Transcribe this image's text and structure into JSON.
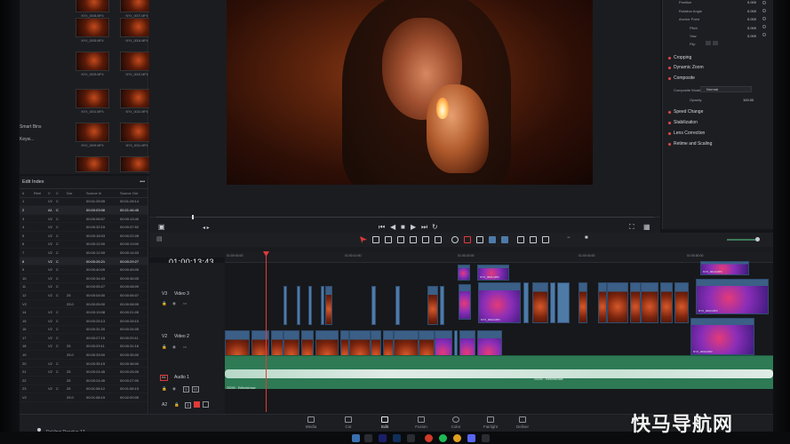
{
  "media_pool": {
    "clip_labels": [
      "NYX_0008.MP4",
      "NYX_0007.MP4",
      "NYX_0005.MP4",
      "NYX_0004.MP4",
      "NYX_0003.MP4",
      "NYX_0002.MP4",
      "NYX_0001.MP4",
      "NYX_0010.MP4",
      "NYX_0009.MP4",
      "NYX_0011.MP4"
    ],
    "smart_bins_label": "Smart Bins",
    "keywords_label": "Keyw..."
  },
  "edit_index": {
    "title": "Edit Index",
    "more": "•••",
    "columns": [
      "#",
      "Reel",
      "V",
      "C",
      "Dur",
      "Source In",
      "Source Out"
    ],
    "rows": [
      [
        "1",
        "",
        "V2",
        "C",
        "",
        "00:01:25:05",
        "00:01:28:14"
      ],
      [
        "2",
        "",
        "A1",
        "C",
        "",
        "00:00:03:06",
        "00:21:46:45"
      ],
      [
        "3",
        "",
        "V2",
        "C",
        "",
        "00:00:08:07",
        "00:00:13:40"
      ],
      [
        "4",
        "",
        "V2",
        "C",
        "",
        "00:00:32:15",
        "00:00:37:52"
      ],
      [
        "5",
        "",
        "V2",
        "C",
        "",
        "00:00:18:03",
        "00:00:22:28"
      ],
      [
        "6",
        "",
        "V2",
        "C",
        "",
        "00:00:12:00",
        "00:00:13:00"
      ],
      [
        "7",
        "",
        "V2",
        "C",
        "",
        "00:00:12:09",
        "00:00:14:03"
      ],
      [
        "8",
        "",
        "V2",
        "C",
        "",
        "00:00:26:21",
        "00:00:29:27"
      ],
      [
        "9",
        "",
        "V2",
        "C",
        "",
        "00:00:40:09",
        "00:00:45:05"
      ],
      [
        "10",
        "",
        "V2",
        "C",
        "",
        "00:00:34:43",
        "00:00:36:05"
      ],
      [
        "11",
        "",
        "V2",
        "C",
        "",
        "00:00:05:27",
        "00:00:08:09"
      ],
      [
        "12",
        "",
        "V2",
        "C",
        "25",
        "00:00:04:00",
        "00:00:06:07"
      ],
      [
        "V2",
        "",
        "",
        "",
        "25.0",
        "00:00:05:00",
        "00:00:08:05"
      ],
      [
        "14",
        "",
        "V2",
        "C",
        "",
        "00:00:19:08",
        "00:00:21:05"
      ],
      [
        "15",
        "",
        "V2",
        "C",
        "",
        "00:00:25:13",
        "00:00:28:15"
      ],
      [
        "16",
        "",
        "V2",
        "C",
        "",
        "00:00:31:20",
        "00:00:34:05"
      ],
      [
        "17",
        "",
        "V2",
        "C",
        "",
        "00:00:27:15",
        "00:00:29:11"
      ],
      [
        "18",
        "",
        "V2",
        "C",
        "25",
        "00:00:29:11",
        "00:00:31:16"
      ],
      [
        "19",
        "",
        "",
        "",
        "25.0",
        "00:00:33:00",
        "00:00:35:00"
      ],
      [
        "20",
        "",
        "V2",
        "C",
        "",
        "00:00:35:15",
        "00:00:38:00"
      ],
      [
        "21",
        "",
        "V2",
        "C",
        "25",
        "00:00:24:45",
        "00:00:26:05"
      ],
      [
        "22",
        "",
        "",
        "",
        "25",
        "00:00:24:45",
        "00:00:27:00"
      ],
      [
        "23",
        "",
        "V2",
        "C",
        "25",
        "00:01:58:12",
        "00:01:58:15"
      ],
      [
        "V2",
        "",
        "",
        "",
        "25.0",
        "00:01:58:15",
        "00:02:00:05"
      ]
    ]
  },
  "inspector": {
    "params": [
      {
        "name": "Position",
        "value": "0.000"
      },
      {
        "name": "Rotation Angle",
        "value": "0.000"
      },
      {
        "name": "Anchor Point",
        "value": "0.000"
      },
      {
        "name": "Pitch",
        "value": "0.000"
      },
      {
        "name": "Yaw",
        "value": "0.000"
      },
      {
        "name": "Flip",
        "value": ""
      }
    ],
    "sections": [
      "Cropping",
      "Dynamic Zoom",
      "Composite",
      "Speed Change",
      "Stabilization",
      "Lens Correction",
      "Retime and Scaling"
    ],
    "composite_mode_label": "Composite Mode",
    "composite_mode_value": "Normal",
    "opacity_label": "Opacity",
    "opacity_value": "100.00"
  },
  "timeline": {
    "timecode": "01:00:13:43",
    "ruler_labels": [
      "01:00:00:00",
      "01:00:10:00",
      "01:00:20:00",
      "01:00:30:00",
      "01:00:40:00",
      "01:00:50:00"
    ],
    "tracks": {
      "v3": {
        "id": "V3",
        "name": "Video 3"
      },
      "v2": {
        "id": "V2",
        "name": "Video 2"
      },
      "a1": {
        "id": "A1",
        "name": "Audio 1"
      },
      "a2": {
        "id": "A2"
      }
    },
    "audio_clip_1": "20200 - Editorial.wav",
    "audio_clip_2": "20200 - Editorial.wav",
    "clip_names": [
      "NYX_0001.MP4",
      "NYX_0002.MP4",
      "NYX_0010.MP4",
      "NYX_0004.MP4",
      "NYX_0009.MP4",
      "NYX_0011.MP4"
    ]
  },
  "page_nav": {
    "items": [
      "Media",
      "Cut",
      "Edit",
      "Fusion",
      "Color",
      "Fairlight",
      "Deliver"
    ],
    "active": "Edit"
  },
  "app_name": "DaVinci Resolve 17",
  "watermark": "快马导航网",
  "colors": {
    "accent": "#e03a3a",
    "clip_blue": "#4e7aa8",
    "audio_green": "#2d7a55"
  }
}
